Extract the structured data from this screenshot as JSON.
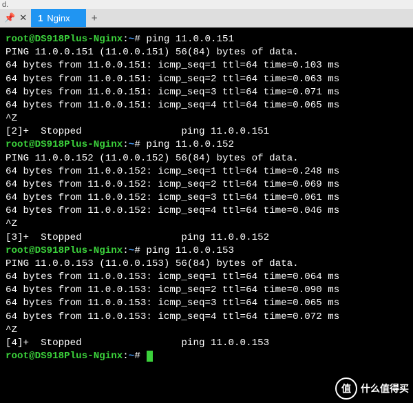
{
  "toolbar": {
    "fragment": "d."
  },
  "tabstrip": {
    "pin_glyph": "📌",
    "close_glyph": "✕",
    "tab": {
      "index": "1",
      "title": "Nginx"
    },
    "add_glyph": "+"
  },
  "prompt": {
    "user_host": "root@DS918Plus-Nginx",
    "path": "~",
    "symbol": "#"
  },
  "sessions": [
    {
      "command": "ping 11.0.0.151",
      "header": "PING 11.0.0.151 (11.0.0.151) 56(84) bytes of data.",
      "replies": [
        "64 bytes from 11.0.0.151: icmp_seq=1 ttl=64 time=0.103 ms",
        "64 bytes from 11.0.0.151: icmp_seq=2 ttl=64 time=0.063 ms",
        "64 bytes from 11.0.0.151: icmp_seq=3 ttl=64 time=0.071 ms",
        "64 bytes from 11.0.0.151: icmp_seq=4 ttl=64 time=0.065 ms"
      ],
      "suspend": "^Z",
      "stopped": "[2]+  Stopped                 ping 11.0.0.151"
    },
    {
      "command": "ping 11.0.0.152",
      "header": "PING 11.0.0.152 (11.0.0.152) 56(84) bytes of data.",
      "replies": [
        "64 bytes from 11.0.0.152: icmp_seq=1 ttl=64 time=0.248 ms",
        "64 bytes from 11.0.0.152: icmp_seq=2 ttl=64 time=0.069 ms",
        "64 bytes from 11.0.0.152: icmp_seq=3 ttl=64 time=0.061 ms",
        "64 bytes from 11.0.0.152: icmp_seq=4 ttl=64 time=0.046 ms"
      ],
      "suspend": "^Z",
      "stopped": "[3]+  Stopped                 ping 11.0.0.152"
    },
    {
      "command": "ping 11.0.0.153",
      "header": "PING 11.0.0.153 (11.0.0.153) 56(84) bytes of data.",
      "replies": [
        "64 bytes from 11.0.0.153: icmp_seq=1 ttl=64 time=0.064 ms",
        "64 bytes from 11.0.0.153: icmp_seq=2 ttl=64 time=0.090 ms",
        "64 bytes from 11.0.0.153: icmp_seq=3 ttl=64 time=0.065 ms",
        "64 bytes from 11.0.0.153: icmp_seq=4 ttl=64 time=0.072 ms"
      ],
      "suspend": "^Z",
      "stopped": "[4]+  Stopped                 ping 11.0.0.153"
    }
  ],
  "watermark": {
    "badge": "值",
    "text": "什么值得买"
  }
}
